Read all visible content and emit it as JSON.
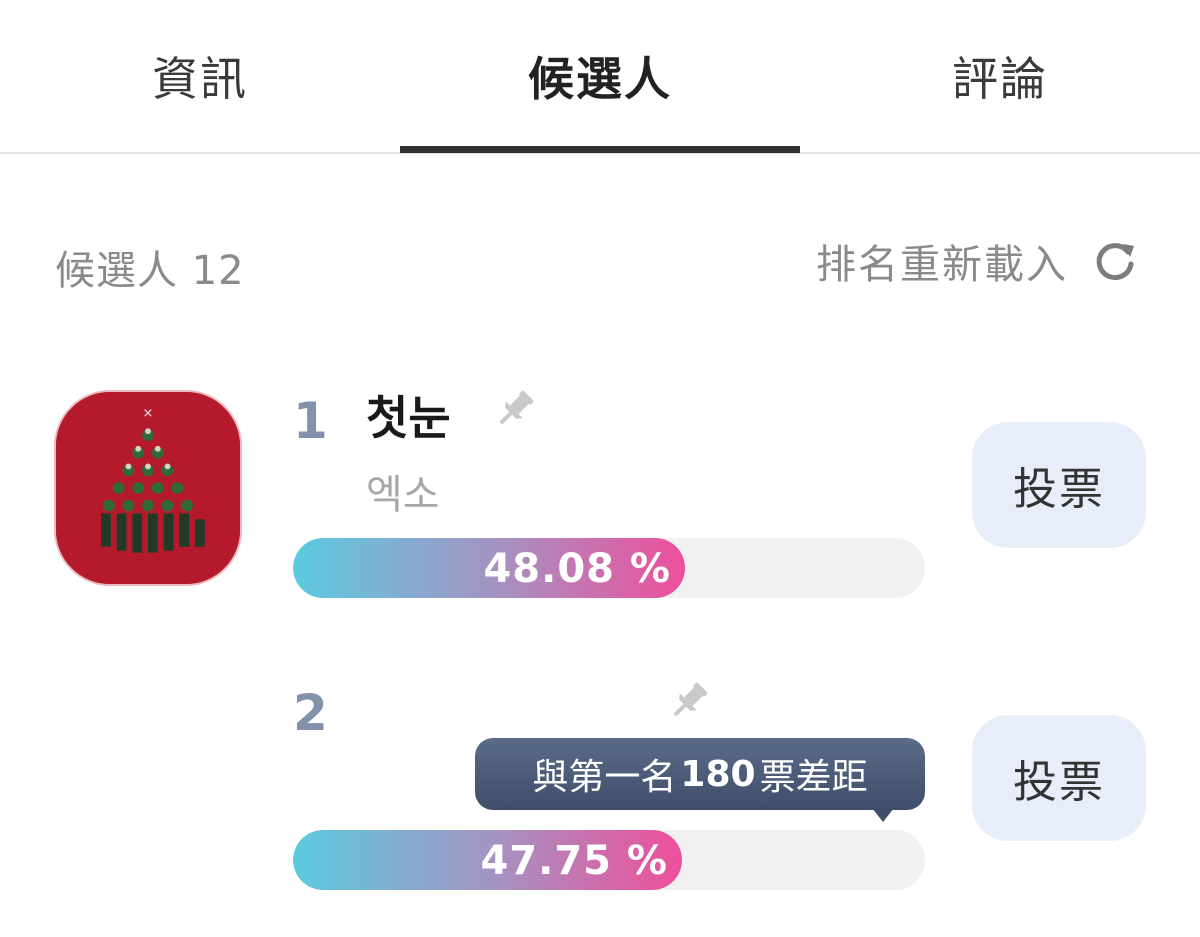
{
  "tabs": [
    {
      "label": "資訊",
      "active": false
    },
    {
      "label": "候選人",
      "active": true
    },
    {
      "label": "評論",
      "active": false
    }
  ],
  "summary": {
    "count_label": "候選人 12",
    "reload_label": "排名重新載入",
    "reload_icon": "refresh-icon"
  },
  "candidates": [
    {
      "rank": "1",
      "title": "첫눈",
      "artist": "엑소",
      "percent": 48.08,
      "percent_label": "48.08 %",
      "vote_label": "投票",
      "pin_icon": "pin-icon"
    },
    {
      "rank": "2",
      "title": "",
      "artist": "",
      "percent": 47.75,
      "percent_label": "47.75 %",
      "vote_label": "投票",
      "pin_icon": "pin-icon",
      "gap_tooltip": {
        "prefix": "與第一名",
        "number": "180",
        "suffix": "票差距"
      }
    }
  ],
  "colors": {
    "bar_gradient_start": "#5ccbe0",
    "bar_gradient_end": "#ee4f9a",
    "rank": "#8392ab",
    "vote_button_bg": "#e8eef9",
    "tooltip_bg": "#4a5a76"
  }
}
